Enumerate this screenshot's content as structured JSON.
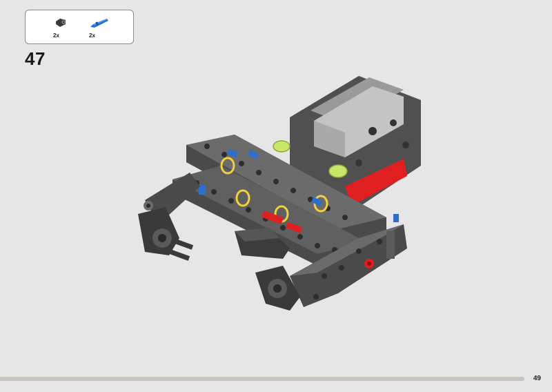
{
  "parts_callout": {
    "items": [
      {
        "icon": "black-connector-icon",
        "quantity": "2x",
        "color": "#3a3a3a"
      },
      {
        "icon": "blue-axle-pin-icon",
        "quantity": "2x",
        "color": "#2b6fd1"
      }
    ]
  },
  "step": {
    "number": "47"
  },
  "page": {
    "number": "49",
    "progress": 0.96
  },
  "colors": {
    "background": "#e6e6e6",
    "beam_dark": "#4a4a4a",
    "beam_mid": "#6b6b6b",
    "accent_red": "#e02020",
    "accent_blue": "#2b6fd1",
    "accent_lime": "#c8e66a",
    "accent_yellow": "#f0d23c",
    "motor_gray": "#bdbdbd"
  }
}
